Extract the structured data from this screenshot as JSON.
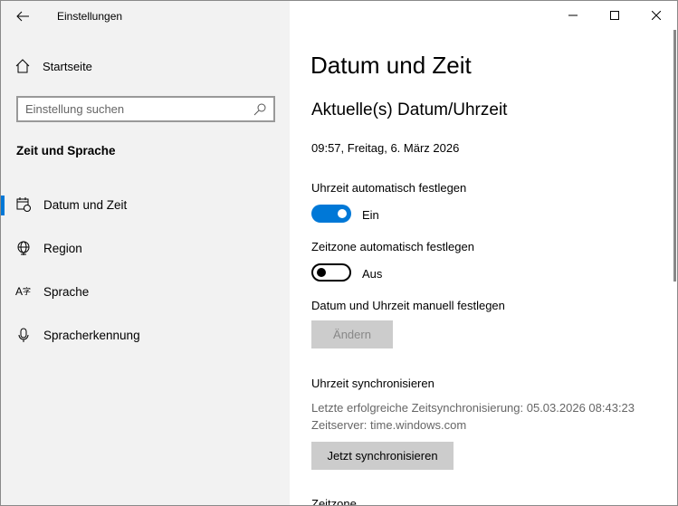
{
  "window": {
    "title": "Einstellungen"
  },
  "sidebar": {
    "home": "Startseite",
    "search_placeholder": "Einstellung suchen",
    "section": "Zeit und Sprache",
    "items": [
      {
        "label": "Datum und Zeit",
        "icon": "calendar-clock-icon",
        "selected": true
      },
      {
        "label": "Region",
        "icon": "globe-icon"
      },
      {
        "label": "Sprache",
        "icon": "language-icon"
      },
      {
        "label": "Spracherkennung",
        "icon": "microphone-icon"
      }
    ]
  },
  "main": {
    "title": "Datum und Zeit",
    "subtitle": "Aktuelle(s) Datum/Uhrzeit",
    "current": "09:57, Freitag, 6. März 2026",
    "auto_time_label": "Uhrzeit automatisch festlegen",
    "auto_time_state": "Ein",
    "auto_zone_label": "Zeitzone automatisch festlegen",
    "auto_zone_state": "Aus",
    "manual_label": "Datum und Uhrzeit manuell festlegen",
    "change_button": "Ändern",
    "sync_heading": "Uhrzeit synchronisieren",
    "last_sync": "Letzte erfolgreiche Zeitsynchronisierung: 05.03.2026 08:43:23",
    "server": "Zeitserver: time.windows.com",
    "sync_button": "Jetzt synchronisieren",
    "timezone_heading": "Zeitzone"
  },
  "colors": {
    "accent": "#0078d7"
  }
}
